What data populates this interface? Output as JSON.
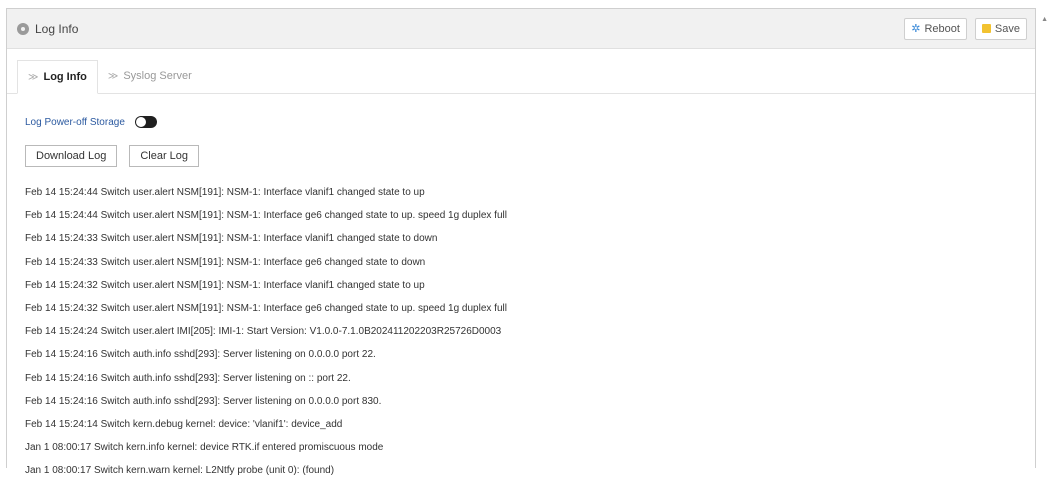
{
  "header": {
    "title": "Log Info",
    "reboot_label": "Reboot",
    "save_label": "Save"
  },
  "tabs": [
    {
      "label": "Log Info",
      "active": true
    },
    {
      "label": "Syslog Server",
      "active": false
    }
  ],
  "storage": {
    "label": "Log Power-off Storage",
    "enabled": false
  },
  "actions": {
    "download_label": "Download Log",
    "clear_label": "Clear Log"
  },
  "logs": [
    "Feb 14 15:24:44 Switch user.alert NSM[191]: NSM-1: Interface vlanif1 changed state to up",
    "Feb 14 15:24:44 Switch user.alert NSM[191]: NSM-1: Interface ge6 changed state to up. speed 1g duplex full",
    "Feb 14 15:24:33 Switch user.alert NSM[191]: NSM-1: Interface vlanif1 changed state to down",
    "Feb 14 15:24:33 Switch user.alert NSM[191]: NSM-1: Interface ge6 changed state to down",
    "Feb 14 15:24:32 Switch user.alert NSM[191]: NSM-1: Interface vlanif1 changed state to up",
    "Feb 14 15:24:32 Switch user.alert NSM[191]: NSM-1: Interface ge6 changed state to up. speed 1g duplex full",
    "Feb 14 15:24:24 Switch user.alert IMI[205]: IMI-1: Start Version: V1.0.0-7.1.0B202411202203R25726D0003",
    "Feb 14 15:24:16 Switch auth.info sshd[293]: Server listening on 0.0.0.0 port 22.",
    "Feb 14 15:24:16 Switch auth.info sshd[293]: Server listening on :: port 22.",
    "Feb 14 15:24:16 Switch auth.info sshd[293]: Server listening on 0.0.0.0 port 830.",
    "Feb 14 15:24:14 Switch kern.debug kernel: device: 'vlanif1': device_add",
    "Jan 1 08:00:17 Switch kern.info kernel: device RTK.if entered promiscuous mode",
    "Jan 1 08:00:17 Switch kern.warn kernel: L2Ntfy probe (unit 0): (found)"
  ]
}
